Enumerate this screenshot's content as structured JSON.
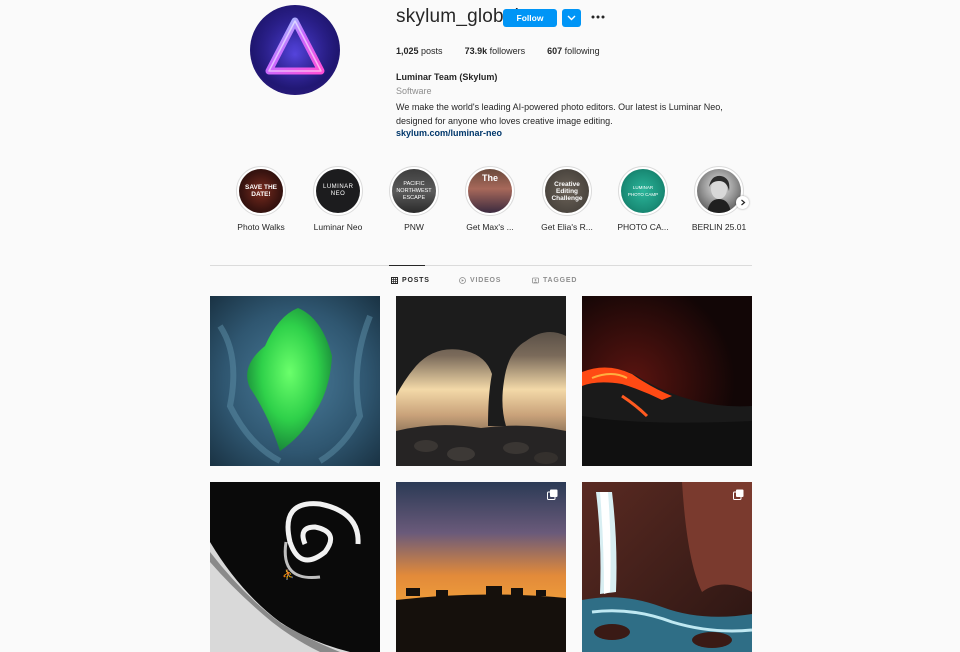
{
  "profile": {
    "username": "skylum_global",
    "follow_label": "Follow",
    "stats": {
      "posts_count": "1,025",
      "posts_label": "posts",
      "followers_count": "73.9k",
      "followers_label": "followers",
      "following_count": "607",
      "following_label": "following"
    },
    "full_name": "Luminar Team (Skylum)",
    "category": "Software",
    "bio_line1": "We make the world's leading AI-powered photo editors. Our latest is Luminar Neo,",
    "bio_line2": "designed for anyone who loves creative image editing.",
    "link": "skylum.com/luminar-neo"
  },
  "highlights": [
    {
      "label": "Photo Walks",
      "cover_text": "SAVE THE DATE!"
    },
    {
      "label": "Luminar Neo",
      "cover_text": "LUMINAR NEO"
    },
    {
      "label": "PNW",
      "cover_text": "PACIFIC NORTHWEST ESCAPE"
    },
    {
      "label": "Get Max's ...",
      "cover_text": "The"
    },
    {
      "label": "Get Elia's R...",
      "cover_text": "Creative Editing Challenge"
    },
    {
      "label": "PHOTO CA...",
      "cover_text": "LUMINAR PHOTO CAMP"
    },
    {
      "label": "BERLIN 25.01",
      "cover_text": ""
    }
  ],
  "tabs": {
    "posts": "POSTS",
    "videos": "VIDEOS",
    "tagged": "TAGGED"
  },
  "icons": {
    "more": "more-options-icon",
    "dropdown": "chevron-down-icon",
    "posts_tab": "grid-icon",
    "videos_tab": "video-icon",
    "tagged_tab": "tag-icon",
    "multi": "carousel-icon",
    "next": "chevron-right-icon"
  },
  "colors": {
    "accent": "#0095f6",
    "link": "#00376b",
    "muted": "#8e8e8e"
  }
}
